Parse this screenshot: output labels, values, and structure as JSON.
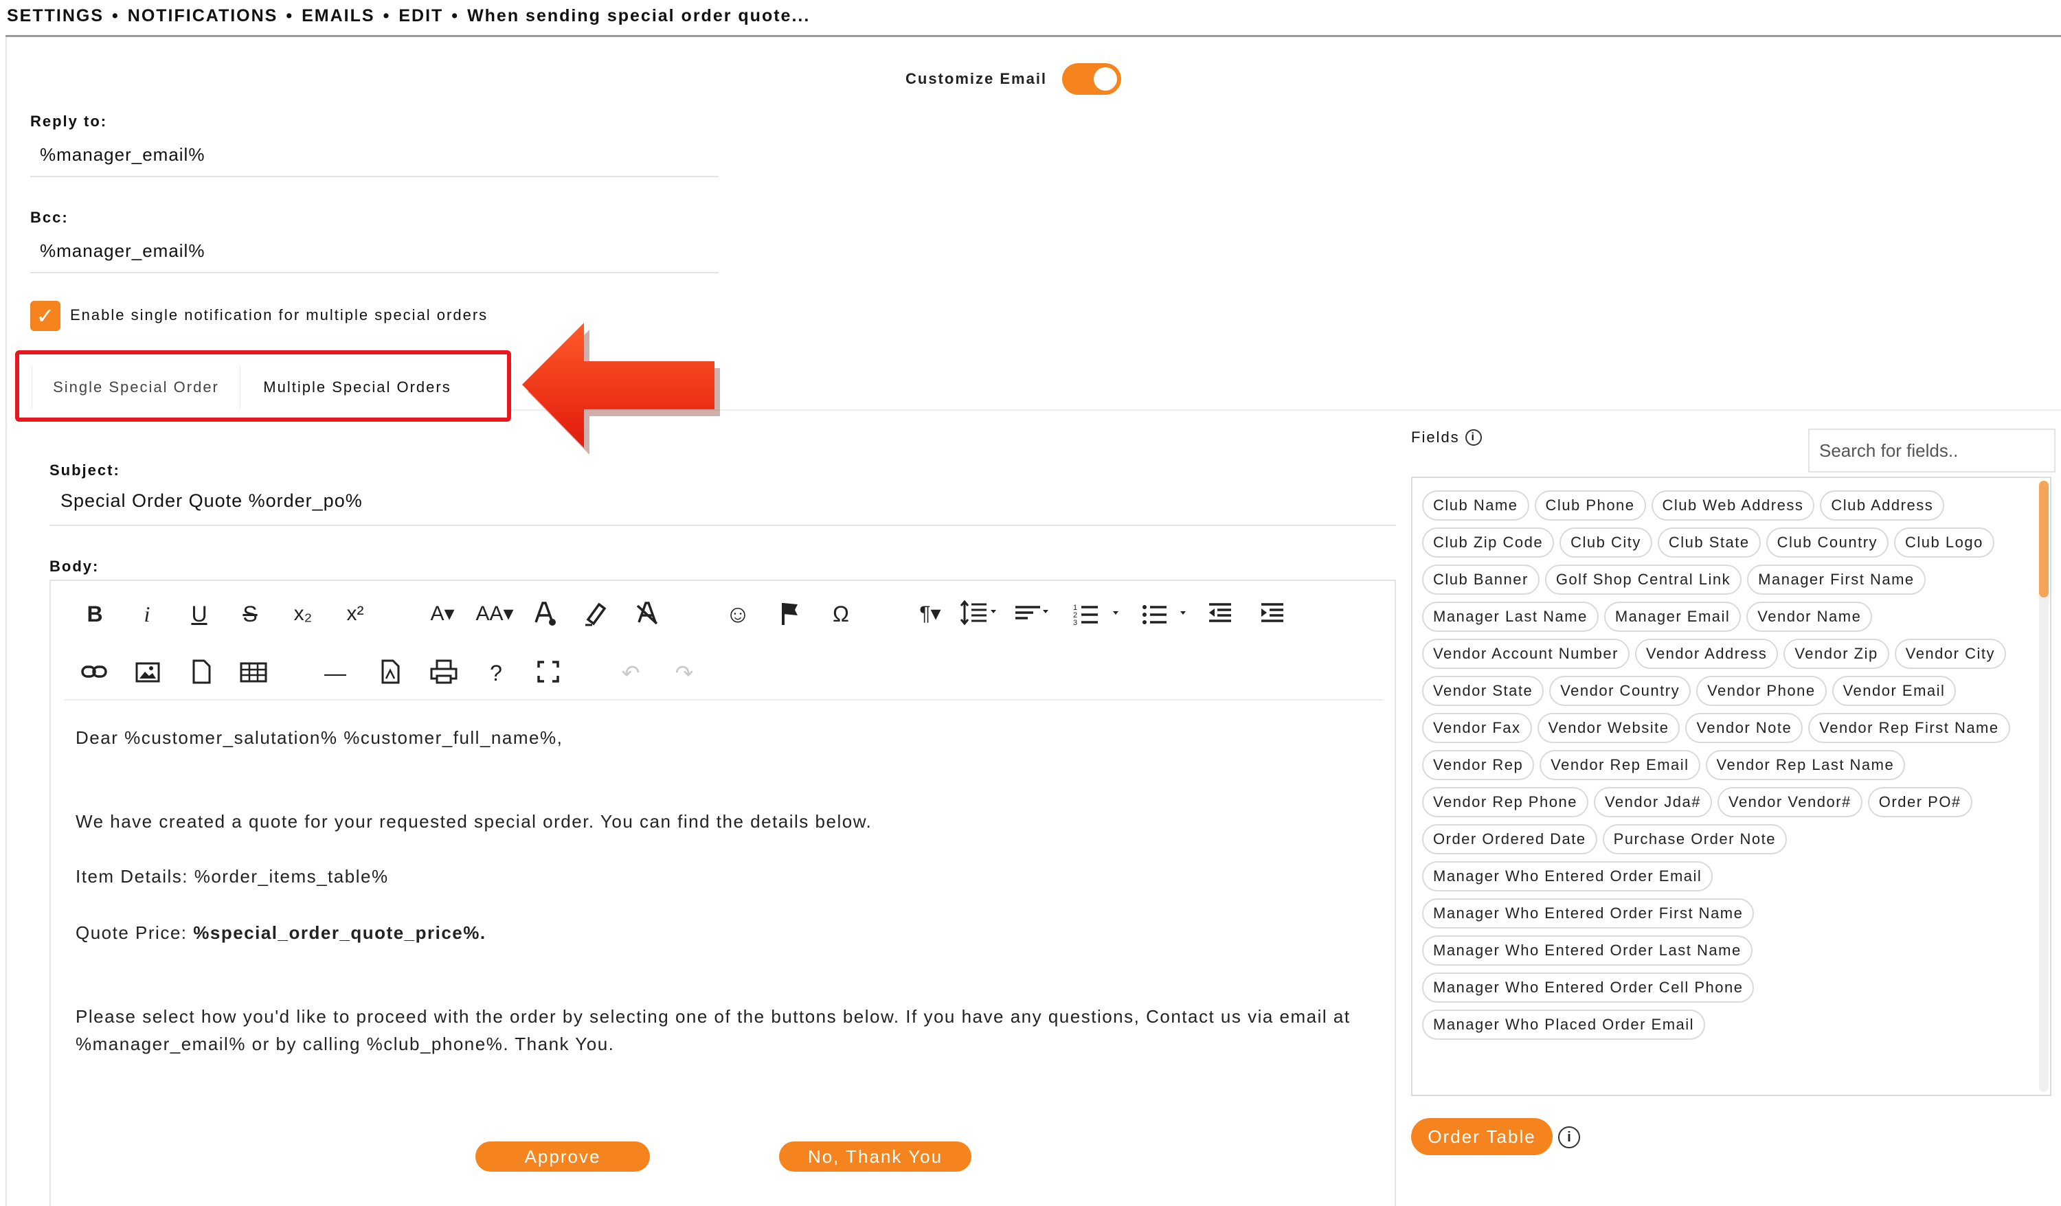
{
  "breadcrumb": {
    "settings": "SETTINGS",
    "notifications": "NOTIFICATIONS",
    "emails": "EMAILS",
    "edit": "EDIT",
    "current": "When sending special order quote...",
    "separator": "•"
  },
  "customize": {
    "label": "Customize Email",
    "enabled": true
  },
  "reply_to": {
    "label": "Reply to:",
    "value": "%manager_email%"
  },
  "bcc": {
    "label": "Bcc:",
    "value": "%manager_email%"
  },
  "single_notification": {
    "label": "Enable single notification for multiple special orders",
    "checked": true
  },
  "tabs": [
    {
      "label": "Single Special Order",
      "active": false
    },
    {
      "label": "Multiple Special Orders",
      "active": true
    }
  ],
  "subject": {
    "label": "Subject:",
    "value": "Special Order Quote %order_po%"
  },
  "body": {
    "label": "Body:",
    "greeting": "Dear %customer_salutation% %customer_full_name%,",
    "line1": "We have created a quote for your requested special order. You can find the details below.",
    "line2": "Item Details: %order_items_table%",
    "line3_prefix": "Quote Price: ",
    "line3_value": "%special_order_quote_price%.",
    "line4a": "Please select how you'd like to proceed with the order by selecting one of the buttons below. If you have any questions, Contact us via email at",
    "line4b": "%manager_email% or by calling %club_phone%. Thank You.",
    "approve": "Approve",
    "decline": "No, Thank You"
  },
  "toolbar": {
    "bold": "B",
    "italic": "i",
    "underline": "U",
    "strike": "S",
    "subscript": "x₂",
    "superscript": "x²",
    "font": "A▾",
    "font_size": "AA▾",
    "emoji": "☺",
    "special_char": "Ω",
    "paragraph": "¶▾",
    "help": "?",
    "hr": "—",
    "undo": "↶",
    "redo": "↷"
  },
  "fields": {
    "label": "Fields",
    "search_placeholder": "Search for fields..",
    "items": [
      "Club Name",
      "Club Phone",
      "Club Web Address",
      "Club Address",
      "Club Zip Code",
      "Club City",
      "Club State",
      "Club Country",
      "Club Logo",
      "Club Banner",
      "Golf Shop Central Link",
      "Manager First Name",
      "Manager Last Name",
      "Manager Email",
      "Vendor Name",
      "Vendor Account Number",
      "Vendor Address",
      "Vendor Zip",
      "Vendor City",
      "Vendor State",
      "Vendor Country",
      "Vendor Phone",
      "Vendor Email",
      "Vendor Fax",
      "Vendor Website",
      "Vendor Note",
      "Vendor Rep First Name",
      "Vendor Rep",
      "Vendor Rep Email",
      "Vendor Rep Last Name",
      "Vendor Rep Phone",
      "Vendor Jda#",
      "Vendor Vendor#",
      "Order PO#",
      "Order Ordered Date",
      "Purchase Order Note",
      "Manager Who Entered Order Email",
      "Manager Who Entered Order First Name",
      "Manager Who Entered Order Last Name",
      "Manager Who Entered Order Cell Phone",
      "Manager Who Placed Order Email"
    ],
    "order_table_button": "Order Table"
  },
  "colors": {
    "accent": "#f5841f",
    "highlight_box": "#e8171f",
    "arrow": "#ee2a12"
  }
}
